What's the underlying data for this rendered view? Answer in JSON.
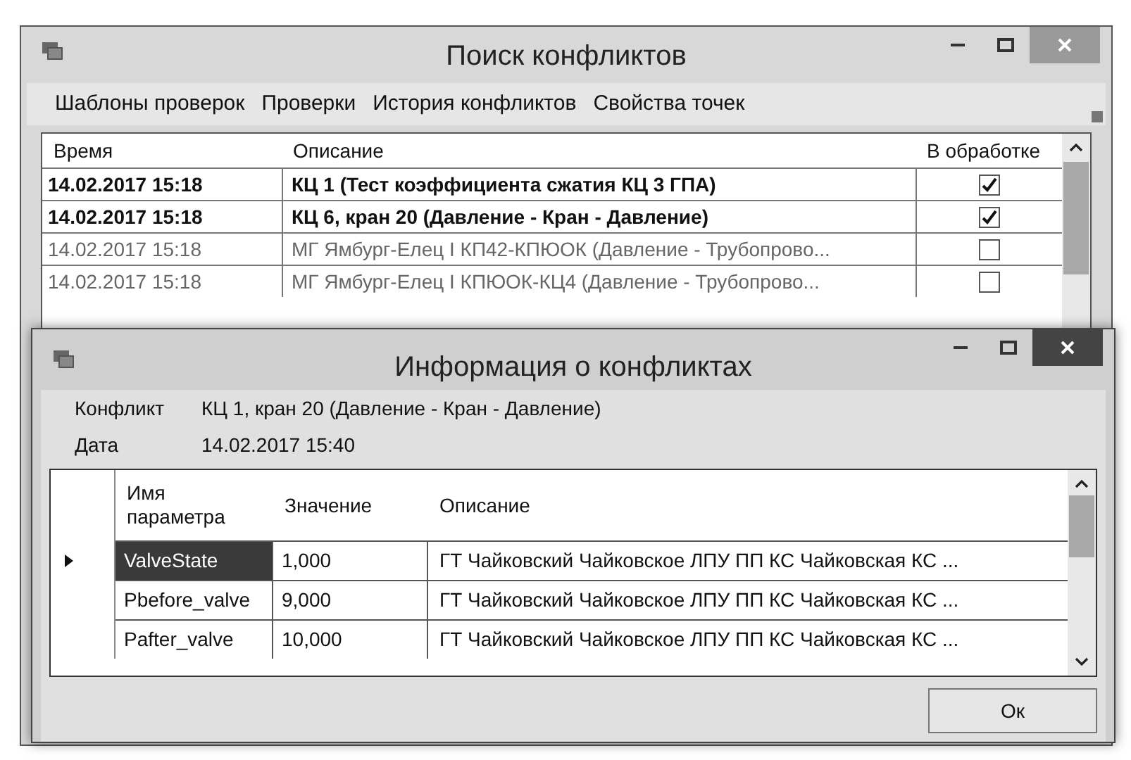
{
  "window": {
    "title": "Поиск конфликтов"
  },
  "menu": [
    "Шаблоны проверок",
    "Проверки",
    "История конфликтов",
    "Свойства точек"
  ],
  "table": {
    "columns": [
      "Время",
      "Описание",
      "В обработке"
    ],
    "rows": [
      {
        "time": "14.02.2017 15:18",
        "description": "КЦ 1 (Тест коэффициента сжатия КЦ 3 ГПА)",
        "checked": true
      },
      {
        "time": "14.02.2017 15:18",
        "description": "КЦ 6, кран 20 (Давление - Кран - Давление)",
        "checked": true
      },
      {
        "time": "14.02.2017 15:18",
        "description": "МГ Ямбург-Елец I КП42-КПЮОК (Давление - Трубопрово...",
        "checked": false
      },
      {
        "time": "14.02.2017 15:18",
        "description": "МГ Ямбург-Елец I КПЮОК-КЦ4 (Давление - Трубопрово...",
        "checked": false
      }
    ]
  },
  "dialog": {
    "title": "Информация о конфликтах",
    "fields": [
      {
        "label": "Конфликт",
        "value": "КЦ 1, кран 20 (Давление - Кран - Давление)"
      },
      {
        "label": "Дата",
        "value": "14.02.2017 15:40"
      }
    ],
    "grid": {
      "columns": [
        "Имя параметра",
        "Значение",
        "Описание"
      ],
      "rows": [
        {
          "name": "ValveState",
          "value": "1,000",
          "description": "ГТ Чайковский Чайковское ЛПУ ПП КС Чайковская КС ...",
          "selected": true
        },
        {
          "name": "Pbefore_valve",
          "value": "9,000",
          "description": "ГТ Чайковский Чайковское ЛПУ ПП КС Чайковская КС ...",
          "selected": false
        },
        {
          "name": "Pafter_valve",
          "value": "10,000",
          "description": "ГТ Чайковский Чайковское ЛПУ ПП КС Чайковская КС ...",
          "selected": false
        }
      ]
    },
    "ok_button": "Ок"
  }
}
